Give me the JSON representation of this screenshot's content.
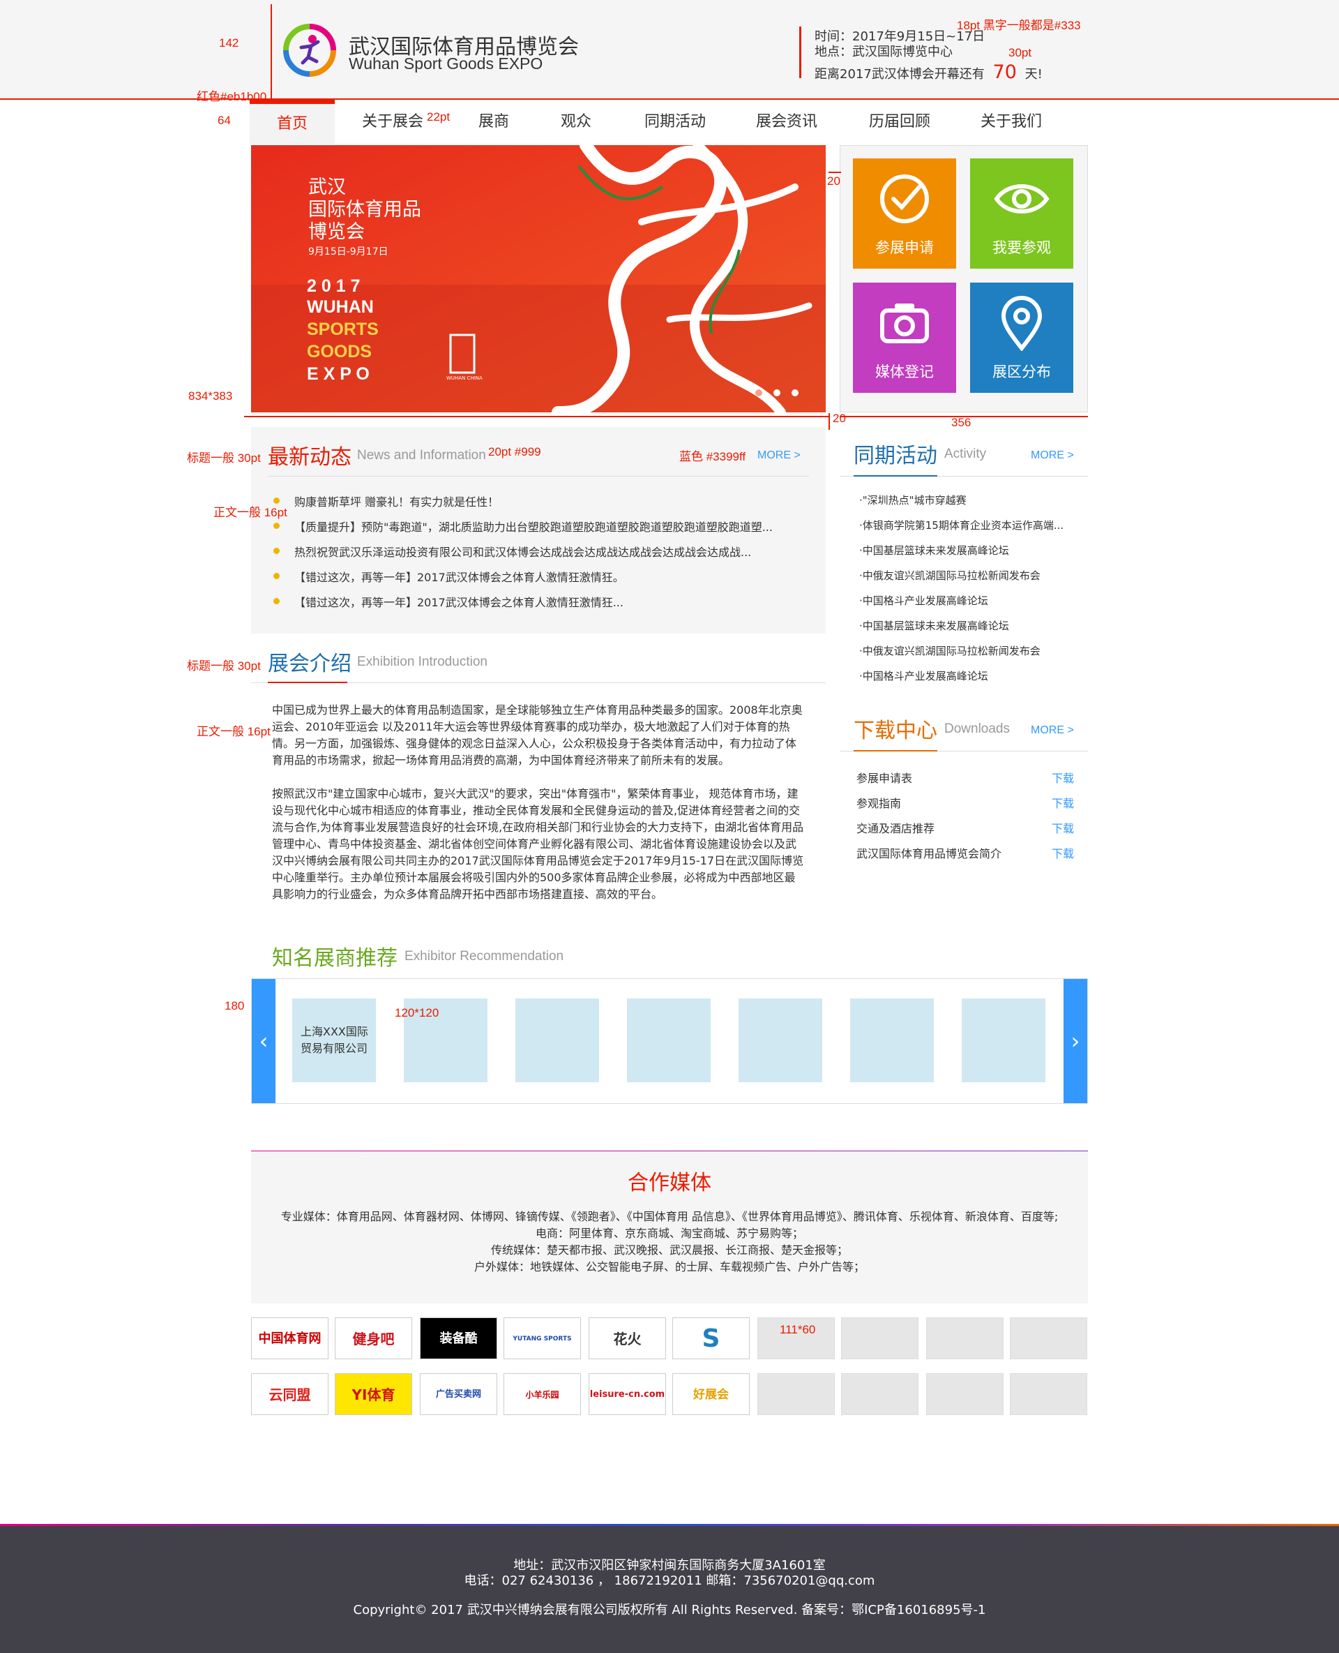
{
  "header": {
    "logo_cn": "武汉国际体育用品博览会",
    "logo_en": "Wuhan Sport Goods EXPO",
    "time": "时间：2017年9月15日~17日",
    "place": "地点：武汉国际博览中心",
    "countdown_prefix": "距离2017武汉体博会开幕还有",
    "countdown_days": "70",
    "countdown_suffix": "天!"
  },
  "nav": {
    "items": [
      {
        "label": "首页"
      },
      {
        "label": "关于展会"
      },
      {
        "label": "展商"
      },
      {
        "label": "观众"
      },
      {
        "label": "同期活动"
      },
      {
        "label": "展会资讯"
      },
      {
        "label": "历届回顾"
      },
      {
        "label": "关于我们"
      }
    ]
  },
  "banner": {
    "title1": "武汉",
    "title2": "国际体育用品",
    "title3": "博览会",
    "dates": "9月15日-9月17日",
    "en1": "2 0 1 7",
    "en2": "WUHAN",
    "en3": "SPORTS",
    "en4": "GOODS",
    "en5": "E X P O",
    "seal_text": "WUHAN CHINA"
  },
  "quick": [
    {
      "label": "参展申请",
      "icon": "check-circle-icon",
      "color": "#f08c00"
    },
    {
      "label": "我要参观",
      "icon": "eye-icon",
      "color": "#7dc51f"
    },
    {
      "label": "媒体登记",
      "icon": "camera-icon",
      "color": "#c23dbf"
    },
    {
      "label": "展区分布",
      "icon": "location-pin-icon",
      "color": "#1f7fc0"
    }
  ],
  "news": {
    "title": "最新动态",
    "sub": "News and Information",
    "more": "MORE >",
    "items": [
      "购康普斯草坪 赠豪礼！有实力就是任性！",
      "【质量提升】预防\"毒跑道\"，湖北质监助力出台塑胶跑道塑胶跑道塑胶跑道塑胶跑道塑胶跑道塑...",
      "热烈祝贺武汉乐泽运动投资有限公司和武汉体博会达成战会达成战达成战会达成战会达成战...",
      "【错过这次，再等一年】2017武汉体博会之体育人激情狂激情狂。",
      "【错过这次，再等一年】2017武汉体博会之体育人激情狂激情狂..."
    ]
  },
  "activity": {
    "title": "同期活动",
    "sub": "Activity",
    "more": "MORE >",
    "items": [
      "·\"深圳热点\"城市穿越赛",
      "·体银商学院第15期体育企业资本运作高端...",
      "·中国基层篮球未来发展高峰论坛",
      "·中俄友谊兴凯湖国际马拉松新闻发布会",
      "·中国格斗产业发展高峰论坛",
      "·中国基层篮球未来发展高峰论坛",
      "·中俄友谊兴凯湖国际马拉松新闻发布会",
      "·中国格斗产业发展高峰论坛"
    ]
  },
  "intro": {
    "title": "展会介绍",
    "sub": "Exhibition Introduction",
    "para1": "中国已成为世界上最大的体育用品制造国家，是全球能够独立生产体育用品种类最多的国家。2008年北京奥运会、2010年亚运会 以及2011年大运会等世界级体育赛事的成功举办，极大地激起了人们对于体育的热情。另一方面，加强锻炼、强身健体的观念日益深入人心，公众积极投身于各类体育活动中，有力拉动了体育用品的市场需求，掀起一场体育用品消费的高潮，为中国体育经济带来了前所未有的发展。",
    "para2": "按照武汉市\"建立国家中心城市，复兴大武汉\"的要求，突出\"体育强市\"，繁荣体育事业， 规范体育市场，建设与现代化中心城市相适应的体育事业，推动全民体育发展和全民健身运动的普及,促进体育经营者之间的交流与合作,为体育事业发展营造良好的社会环境,在政府相关部门和行业协会的大力支持下，由湖北省体育用品管理中心、青鸟中体投资基金、湖北省体创空间体育产业孵化器有限公司、湖北省体育设施建设协会以及武汉中兴博纳会展有限公司共同主办的2017武汉国际体育用品博览会定于2017年9月15-17日在武汉国际博览中心隆重举行。主办单位预计本届展会将吸引国内外的500多家体育品牌企业参展，必将成为中西部地区最具影响力的行业盛会，为众多体育品牌开拓中西部市场搭建直接、高效的平台。"
  },
  "downloads": {
    "title": "下载中心",
    "sub": "Downloads",
    "more": "MORE >",
    "btn": "下载",
    "items": [
      "参展申请表",
      "参观指南",
      "交通及酒店推荐",
      "武汉国际体育用品博览会简介"
    ]
  },
  "exhibitors": {
    "title": "知名展商推荐",
    "sub": "Exhibitor Recommendation",
    "first_name": "上海XXX国际贸易有限公司",
    "prev": "‹",
    "next": "›"
  },
  "media": {
    "title": "合作媒体",
    "line1": "专业媒体：体育用品网、体育器材网、体博网、锋镝传媒、《领跑者》、《中国体育用 品信息》、《世界体育用品博览》、腾讯体育、乐视体育、新浪体育、百度等;",
    "line2": "电商：阿里体育、京东商城、淘宝商城、苏宁易购等；",
    "line3": "传统媒体：楚天都市报、武汉晚报、武汉晨报、长江商报、楚天金报等；",
    "line4": "户外媒体：地铁媒体、公交智能电子屏、的士屏、车载视频广告、户外广告等；",
    "logos_row1": [
      "中国体育网",
      "健身吧",
      "装备酷",
      "YUTANG SPORTS",
      "花火",
      "S"
    ],
    "logos_row2": [
      "云同盟",
      "YI体育",
      "广告买卖网",
      "小羊乐园",
      "leisure-cn.com",
      "好展会"
    ]
  },
  "annotations": {
    "h142": "142",
    "font_note": "18pt 黑字一般都是#333",
    "pt30": "30pt",
    "red": "红色#eb1b00",
    "h64": "64",
    "pt22": "22pt",
    "d20a": "20",
    "d20b": "20",
    "w356": "356",
    "size834": "834*383",
    "title30a": "标题一般 30pt",
    "sub20": "20pt #999",
    "blue": "蓝色 #3399ff",
    "body16a": "正文一般 16pt",
    "title30b": "标题一般 30pt",
    "body16b": "正文一般 16pt",
    "h180": "180",
    "size120": "120*120",
    "size111": "111*60"
  },
  "footer": {
    "address": "地址：武汉市汉阳区钟家村闽东国际商务大厦3A1601室",
    "contact": "电话：027 62430136 ， 18672192011    邮箱：735670201@qq.com",
    "copyright": "Copyright© 2017 武汉中兴博纳会展有限公司版权所有 All Rights Reserved.  备案号：鄂ICP备16016895号-1"
  },
  "colors": {
    "brand_red": "#eb1b00",
    "link_blue": "#3399ff",
    "text": "#333333",
    "muted": "#999999",
    "green_title": "#6aaa1f",
    "orange_title": "#e86b00",
    "blue_title": "#1f6fae"
  }
}
